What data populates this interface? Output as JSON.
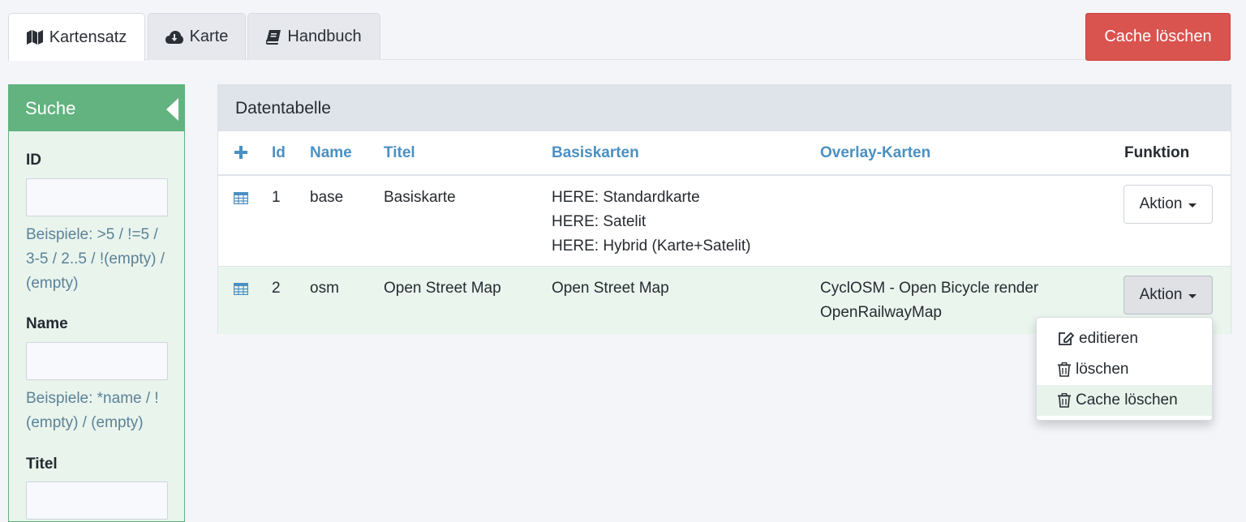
{
  "tabs": [
    {
      "label": "Kartensatz",
      "icon": "map-icon",
      "active": true
    },
    {
      "label": "Karte",
      "icon": "cloud-download-icon",
      "active": false
    },
    {
      "label": "Handbuch",
      "icon": "book-icon",
      "active": false
    }
  ],
  "header": {
    "cache_button": "Cache löschen"
  },
  "search": {
    "title": "Suche",
    "fields": [
      {
        "label": "ID",
        "value": "",
        "hint": "Beispiele: >5 / !=5 / 3-5 / 2..5 / !(empty) / (empty)"
      },
      {
        "label": "Name",
        "value": "",
        "hint": "Beispiele: *name / !(empty) / (empty)"
      },
      {
        "label": "Titel",
        "value": ""
      }
    ]
  },
  "table": {
    "title": "Datentabelle",
    "columns": [
      "Id",
      "Name",
      "Titel",
      "Basiskarten",
      "Overlay-Karten",
      "Funktion"
    ],
    "rows": [
      {
        "id": "1",
        "name": "base",
        "titel": "Basiskarte",
        "basiskarten": [
          "HERE: Standardkarte",
          "HERE: Satelit",
          "HERE: Hybrid (Karte+Satelit)"
        ],
        "overlay": [],
        "action": "Aktion"
      },
      {
        "id": "2",
        "name": "osm",
        "titel": "Open Street Map",
        "basiskarten": [
          "Open Street Map"
        ],
        "overlay": [
          "CyclOSM - Open Bicycle render",
          "OpenRailwayMap"
        ],
        "action": "Aktion"
      }
    ]
  },
  "dropdown": {
    "items": [
      {
        "label": "editieren",
        "icon": "edit-icon"
      },
      {
        "label": "löschen",
        "icon": "trash-icon"
      },
      {
        "label": "Cache löschen",
        "icon": "trash-icon",
        "hover": true
      }
    ]
  },
  "colors": {
    "accent_green": "#62b37f",
    "danger": "#d9534f",
    "link_blue": "#4a90c2"
  }
}
